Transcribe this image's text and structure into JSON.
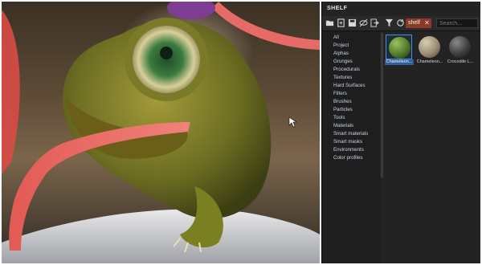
{
  "shelf": {
    "title": "SHELF",
    "search_tag": "shelf",
    "search_placeholder": "Search...",
    "categories": [
      "All",
      "Project",
      "Alphas",
      "Grunges",
      "Procedurals",
      "Textures",
      "Hard Surfaces",
      "Filters",
      "Brushes",
      "Particles",
      "Tools",
      "Materials",
      "Smart materials",
      "Smart masks",
      "Environments",
      "Color profiles"
    ],
    "assets": [
      {
        "label": "Chameleon...",
        "selected": true,
        "color": "#4f7a2a"
      },
      {
        "label": "Chameleon...",
        "selected": false,
        "color": "#9a8d74"
      },
      {
        "label": "Crocodile L...",
        "selected": false,
        "color": "#5a5a5a"
      }
    ],
    "toolbar_icons": [
      "folder-icon",
      "new-file-icon",
      "save-icon",
      "hide-icon",
      "export-icon",
      "filter-icon",
      "refresh-icon"
    ]
  },
  "viewport": {
    "subject": "chameleon-3d-model"
  }
}
